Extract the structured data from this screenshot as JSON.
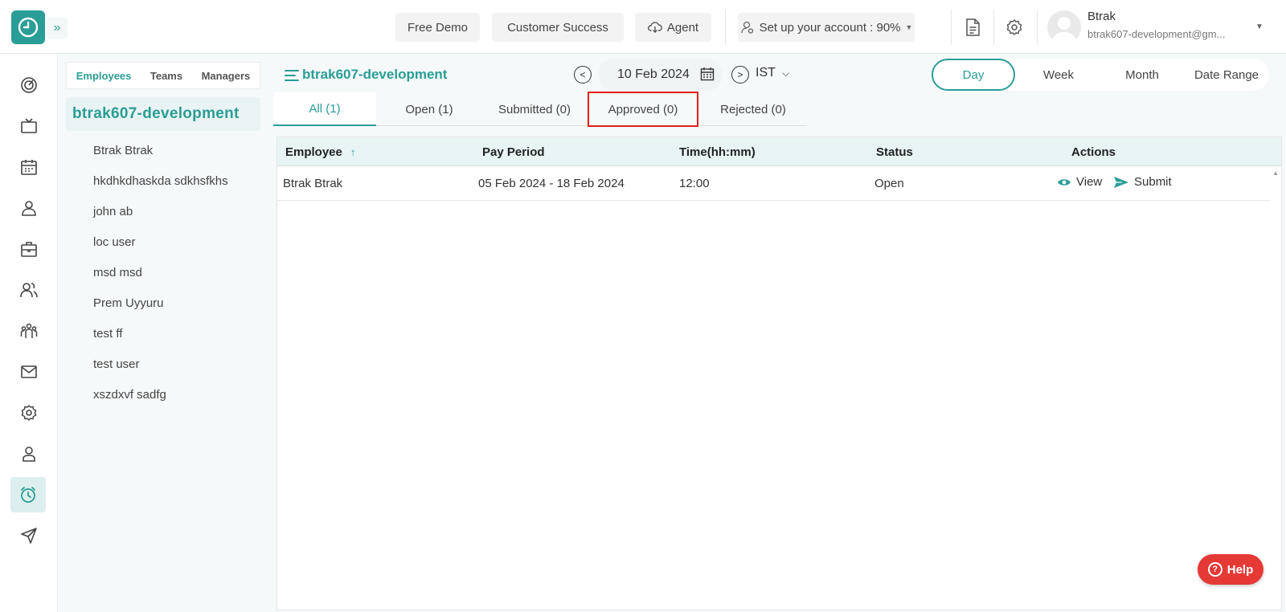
{
  "topbar": {
    "free_demo": "Free Demo",
    "customer_success": "Customer Success",
    "agent": "Agent",
    "setup": "Set up your account : 90%",
    "user_name": "Btrak",
    "user_email": "btrak607-development@gm..."
  },
  "employees_panel": {
    "tabs": [
      "Employees",
      "Teams",
      "Managers"
    ],
    "team_name": "btrak607-development",
    "employees": [
      "Btrak Btrak",
      "hkdhkdhaskda sdkhsfkhs",
      "john ab",
      "loc user",
      "msd msd",
      "Prem Uyyuru",
      "test ff",
      "test user",
      "xszdxvf sadfg"
    ]
  },
  "main": {
    "team_title": "btrak607-development",
    "date": "10 Feb 2024",
    "timezone": "IST",
    "ranges": [
      "Day",
      "Week",
      "Month",
      "Date Range"
    ],
    "status_tabs": [
      "All (1)",
      "Open (1)",
      "Submitted (0)",
      "Approved (0)",
      "Rejected (0)"
    ],
    "columns": [
      "Employee",
      "Pay Period",
      "Time(hh:mm)",
      "Status",
      "Actions"
    ],
    "rows": [
      {
        "employee": "Btrak Btrak",
        "pay_period": "05 Feb 2024 - 18 Feb 2024",
        "time": "12:00",
        "status": "Open",
        "view": "View",
        "submit": "Submit"
      }
    ]
  },
  "help": "Help",
  "colors": {
    "accent": "#2a9d96",
    "highlight": "#e02020",
    "help": "#e53935"
  }
}
